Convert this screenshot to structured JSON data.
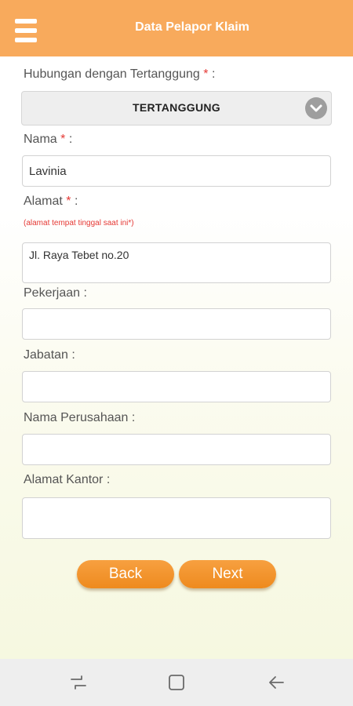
{
  "header": {
    "title": "Data Pelapor Klaim",
    "menu_icon": "hamburger-menu-icon"
  },
  "form": {
    "relationship": {
      "label": "Hubungan dengan Tertanggung",
      "required_mark": "*",
      "colon": ":",
      "value": "TERTANGGUNG"
    },
    "name": {
      "label": "Nama",
      "required_mark": "*",
      "colon": ":",
      "value": "Lavinia"
    },
    "address": {
      "label": "Alamat",
      "required_mark": "*",
      "colon": ":",
      "hint": "(alamat tempat tinggal saat ini*)",
      "value": "Jl. Raya Tebet no.20"
    },
    "occupation": {
      "label": "Pekerjaan    :",
      "value": ""
    },
    "position": {
      "label": "Jabatan    :",
      "value": ""
    },
    "company_name": {
      "label": "Nama Perusahaan    :",
      "value": ""
    },
    "office_address": {
      "label": "Alamat Kantor    :",
      "value": ""
    }
  },
  "buttons": {
    "back": "Back",
    "next": "Next"
  },
  "nav_bar": {
    "recent": "recent-apps-icon",
    "home": "home-icon",
    "back": "back-arrow-icon"
  },
  "colors": {
    "header": "#f8aa5c",
    "button": "#f0902a",
    "required": "#e53935",
    "navbar": "#eeeeee"
  }
}
